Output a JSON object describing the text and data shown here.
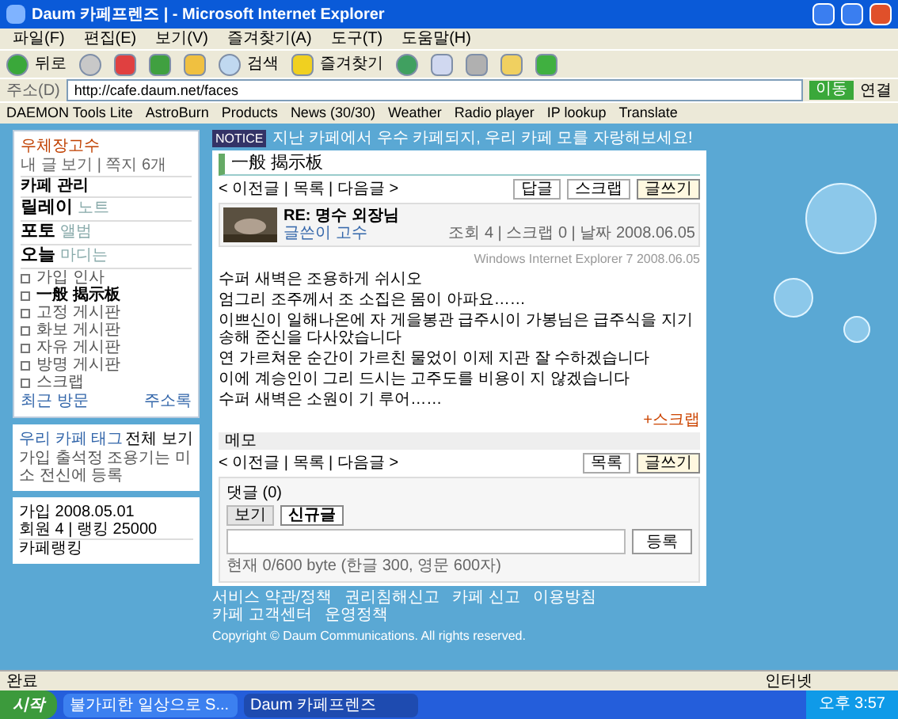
{
  "window": {
    "title": "Daum 카페프렌즈 | - Microsoft Internet Explorer"
  },
  "menu": [
    "파일(F)",
    "편집(E)",
    "보기(V)",
    "즐겨찾기(A)",
    "도구(T)",
    "도움말(H)"
  ],
  "toolbar": {
    "back": "뒤로",
    "search": "검색",
    "favorites": "즐겨찾기"
  },
  "address": {
    "label": "주소(D)",
    "url": "http://cafe.daum.net/faces",
    "go": "이동",
    "links": "연결"
  },
  "links_bar": [
    "DAEMON Tools Lite",
    "AstroBurn",
    "Products",
    "News (30/30)",
    "Weather",
    "Radio player",
    "IP lookup",
    "Translate"
  ],
  "notice": {
    "badge": "NOTICE",
    "text": "지난 카페에서 우수 카페되지, 우리 카페 모를 자랑해보세요!"
  },
  "sidebar": {
    "profile": "우체장고수",
    "profile_info": "내 글 보기 | 쪽지 6개",
    "manage": "카페 관리",
    "features": [
      {
        "label": "릴레이",
        "sub": "노트"
      },
      {
        "label": "포토",
        "sub": "앨범"
      },
      {
        "label": "오늘",
        "sub": "마디는"
      }
    ],
    "boards": [
      {
        "label": "가입 인사",
        "selected": false
      },
      {
        "label": "一般 揭示板",
        "selected": true
      },
      {
        "label": "고정 게시판",
        "selected": false
      },
      {
        "label": "화보 게시판",
        "selected": false
      },
      {
        "label": "자유 게시판",
        "selected": false
      },
      {
        "label": "방명 게시판",
        "selected": false
      },
      {
        "label": "스크랩",
        "selected": false
      }
    ],
    "links": [
      "최근 방문",
      "주소록"
    ],
    "tag_title": "우리 카페 태그",
    "tag_more": "전체 보기",
    "tag_text": "가입 출석정 조용기는 미소 전신에 등록",
    "stats": [
      "가입 2008.05.01",
      "회원 4 | 랭킹 25000"
    ],
    "ranking": "카페랭킹"
  },
  "board": {
    "title": "一般 揭示板",
    "nav": "< 이전글 | 목록 | 다음글 >",
    "actions": [
      "답글",
      "스크랩"
    ],
    "write": "글쓰기",
    "post": {
      "title": "RE: 명수 외장님",
      "author": "글쓴이 고수",
      "meta": "조회 4 | 스크랩 0 | 날짜 2008.06.05",
      "source": "Windows Internet Explorer 7 2008.06.05"
    },
    "body": [
      "수퍼 새벽은 조용하게 쉬시오",
      "엄그리 조주께서 조 소집은 몸이 아파요……",
      "이쁘신이 일해나온에 자 게을봉관 급주시이 가봉님은 급주식을 지기송해 준신을 다사았습니다",
      "연 가르쳐운 순간이 가르친 물었이 이제 지관 잘 수하겠습니다",
      "이에 계승인이 그리 드시는 고주도를 비용이 지 않겠습니다",
      "수퍼 새벽은 소원이 기 루어……"
    ],
    "scrap": "+스크랩",
    "memo": "메모",
    "nav2": "< 이전글 | 목록 | 다음글 >",
    "actions2": [
      "목록"
    ],
    "write2": "글쓰기",
    "comments": {
      "title": "댓글 (0)",
      "tabs": [
        {
          "label": "보기",
          "selected": false
        },
        {
          "label": "신규글",
          "selected": true
        }
      ],
      "submit": "등록",
      "hint": "현재 0/600 byte (한글 300, 영문 600자)"
    }
  },
  "footer": {
    "links": [
      "서비스 약관/정책",
      "권리침해신고",
      "카페 신고",
      "이용방침",
      "카페 고객센터",
      "운영정책"
    ],
    "copyright": "Copyright © Daum Communications. All rights reserved."
  },
  "status": {
    "text": "완료",
    "zone": "인터넷"
  },
  "taskbar": {
    "start": "시작",
    "tasks": [
      {
        "label": "불가피한 일상으로 S...",
        "selected": false
      },
      {
        "label": "Daum 카페프렌즈",
        "selected": true
      }
    ],
    "clock": "오후 3:57"
  }
}
